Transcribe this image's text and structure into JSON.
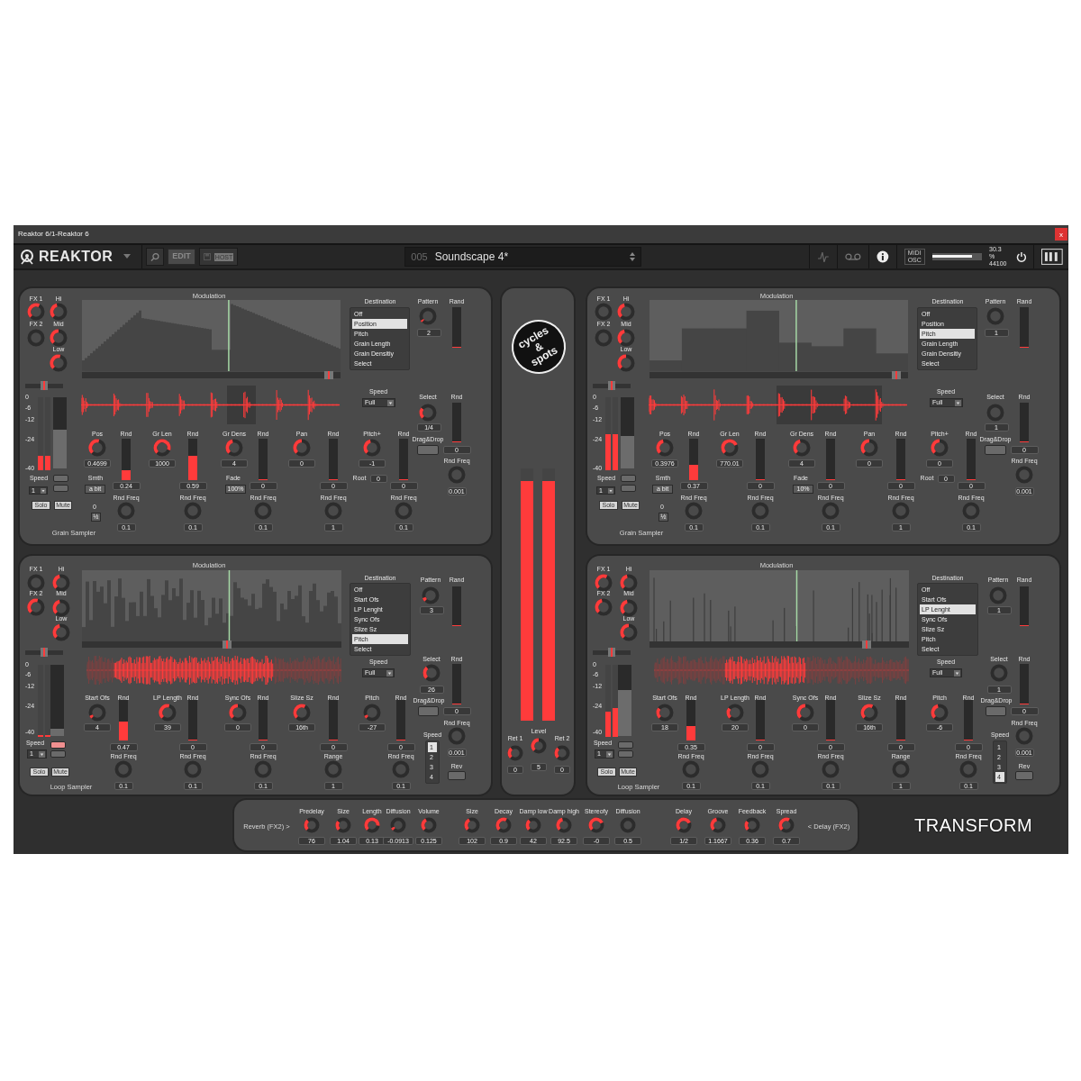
{
  "window": {
    "title": "Reaktor 6/1-Reaktor 6",
    "close": "x"
  },
  "toolbar": {
    "app_name": "REAKTOR",
    "edit": "EDIT",
    "host": "HOST",
    "preset_number": "005",
    "preset_name": "Soundscape 4*",
    "midi": "MIDI",
    "osc": "OSC",
    "volume": {
      "level": 0.8
    },
    "cpu": "30.3 %",
    "sample_rate": "44100"
  },
  "samplers": [
    {
      "kind": "grain",
      "title": "Grain Sampler",
      "modulation_title": "Modulation",
      "fx": [
        {
          "label": "FX 1"
        },
        {
          "label": "FX 2"
        }
      ],
      "eq": [
        {
          "label": "Hi"
        },
        {
          "label": "Mid"
        },
        {
          "label": "Low"
        }
      ],
      "scale": [
        "0",
        "-6",
        "-12",
        "-24",
        "-40"
      ],
      "pan": {
        "level": 0.5
      },
      "meters": [
        {
          "level": 0.2
        },
        {
          "level": 0.2
        }
      ],
      "fader": {
        "level": 0.55
      },
      "speed": {
        "label": "Speed",
        "value": "1"
      },
      "toggles": [
        {
          "on": false
        },
        {
          "on": false
        }
      ],
      "solo": "Solo",
      "mute": "Mute",
      "destination": {
        "label": "Destination",
        "items": [
          {
            "label": "Off",
            "selected": false
          },
          {
            "label": "Position",
            "selected": true
          },
          {
            "label": "Pitch",
            "selected": false
          },
          {
            "label": "Grain Length",
            "selected": false
          },
          {
            "label": "Grain Densitiy",
            "selected": false
          },
          {
            "label": "Select",
            "selected": false
          }
        ]
      },
      "pattern": {
        "label": "Pattern",
        "value": "2"
      },
      "rand": {
        "label": "Rand",
        "level": 0.02
      },
      "mod_speed": {
        "label": "Speed",
        "value": "Full"
      },
      "select": {
        "label": "Select",
        "value": "1/4"
      },
      "select_rnd": {
        "label": "Rnd",
        "value": "0",
        "level": 0.02
      },
      "drag_drop": "Drag&Drop",
      "rnd_freq": {
        "label": "Rnd Freq",
        "value": "0.001"
      },
      "params": [
        {
          "label": "Pos",
          "value": "0.4699",
          "rnd": {
            "label": "Rnd",
            "value": "0.24",
            "level": 0.24
          },
          "freq": {
            "label": "Rnd Freq",
            "value": "0.1"
          }
        },
        {
          "label": "Gr Len",
          "value": "1000",
          "rnd": {
            "label": "Rnd",
            "value": "0.59",
            "level": 0.59
          },
          "freq": {
            "label": "Rnd Freq",
            "value": "0.1"
          }
        },
        {
          "label": "Gr Dens",
          "value": "4",
          "rnd": {
            "label": "Rnd",
            "value": "0",
            "level": 0.02
          },
          "freq": {
            "label": "Rnd Freq",
            "value": "0.1"
          }
        },
        {
          "label": "Pan",
          "value": "0",
          "rnd": {
            "label": "Rnd",
            "value": "0",
            "level": 0.02
          },
          "freq": {
            "label": "Rnd Freq",
            "value": "1"
          }
        },
        {
          "label": "Pitch+",
          "value": "-1",
          "rnd": {
            "label": "Rnd",
            "value": "0",
            "level": 0.02
          },
          "freq": {
            "label": "Rnd Freq",
            "value": "0.1"
          }
        }
      ],
      "extras": [
        {
          "kind": "button",
          "label": "Smth",
          "value": "a bit"
        },
        {
          "kind": "button",
          "label": "0",
          "value": "½"
        },
        {
          "kind": "button",
          "label": "Fade",
          "value": "100%"
        },
        {
          "kind": "readout",
          "label": "Root",
          "value": "0"
        }
      ]
    },
    {
      "kind": "grain",
      "title": "Grain Sampler",
      "modulation_title": "Modulation",
      "fx": [
        {
          "label": "FX 1"
        },
        {
          "label": "FX 2"
        }
      ],
      "eq": [
        {
          "label": "Hi"
        },
        {
          "label": "Mid"
        },
        {
          "label": "Low"
        }
      ],
      "scale": [
        "0",
        "-6",
        "-12",
        "-24",
        "-40"
      ],
      "pan": {
        "level": 0.5
      },
      "meters": [
        {
          "level": 0.5
        },
        {
          "level": 0.5
        }
      ],
      "fader": {
        "level": 0.45
      },
      "speed": {
        "label": "Speed",
        "value": "1"
      },
      "toggles": [
        {
          "on": false
        },
        {
          "on": false
        }
      ],
      "solo": "Solo",
      "mute": "Mute",
      "destination": {
        "label": "Destination",
        "items": [
          {
            "label": "Off",
            "selected": false
          },
          {
            "label": "Position",
            "selected": false
          },
          {
            "label": "Pitch",
            "selected": true
          },
          {
            "label": "Grain Length",
            "selected": false
          },
          {
            "label": "Grain Densitiy",
            "selected": false
          },
          {
            "label": "Select",
            "selected": false
          }
        ]
      },
      "pattern": {
        "label": "Pattern",
        "value": "1"
      },
      "rand": {
        "label": "Rand",
        "level": 0.02
      },
      "mod_speed": {
        "label": "Speed",
        "value": "Full"
      },
      "select": {
        "label": "Select",
        "value": "1"
      },
      "select_rnd": {
        "label": "Rnd",
        "value": "0",
        "level": 0.02
      },
      "drag_drop": "Drag&Drop",
      "rnd_freq": {
        "label": "Rnd Freq",
        "value": "0.001"
      },
      "params": [
        {
          "label": "Pos",
          "value": "0.3976",
          "rnd": {
            "label": "Rnd",
            "value": "0.37",
            "level": 0.37
          },
          "freq": {
            "label": "Rnd Freq",
            "value": "0.1"
          }
        },
        {
          "label": "Gr Len",
          "value": "770.01",
          "rnd": {
            "label": "Rnd",
            "value": "0",
            "level": 0.02
          },
          "freq": {
            "label": "Rnd Freq",
            "value": "0.1"
          }
        },
        {
          "label": "Gr Dens",
          "value": "4",
          "rnd": {
            "label": "Rnd",
            "value": "0",
            "level": 0.02
          },
          "freq": {
            "label": "Rnd Freq",
            "value": "0.1"
          }
        },
        {
          "label": "Pan",
          "value": "0",
          "rnd": {
            "label": "Rnd",
            "value": "0",
            "level": 0.02
          },
          "freq": {
            "label": "Rnd Freq",
            "value": "1"
          }
        },
        {
          "label": "Pitch+",
          "value": "0",
          "rnd": {
            "label": "Rnd",
            "value": "0",
            "level": 0.02
          },
          "freq": {
            "label": "Rnd Freq",
            "value": "0.1"
          }
        }
      ],
      "extras": [
        {
          "kind": "button",
          "label": "Smth",
          "value": "a bit"
        },
        {
          "kind": "button",
          "label": "0",
          "value": "½"
        },
        {
          "kind": "button",
          "label": "Fade",
          "value": "10%"
        },
        {
          "kind": "readout",
          "label": "Root",
          "value": "0"
        }
      ]
    },
    {
      "kind": "loop",
      "title": "Loop Sampler",
      "modulation_title": "Modulation",
      "fx": [
        {
          "label": "FX 1"
        },
        {
          "label": "FX 2"
        }
      ],
      "eq": [
        {
          "label": "Hi"
        },
        {
          "label": "Mid"
        },
        {
          "label": "Low"
        }
      ],
      "scale": [
        "0",
        "-6",
        "-12",
        "-24",
        "-40"
      ],
      "pan": {
        "level": 0.5
      },
      "meters": [
        {
          "level": 0.03
        },
        {
          "level": 0.03
        }
      ],
      "fader": {
        "level": 0.1
      },
      "speed": {
        "label": "Speed",
        "value": "1"
      },
      "toggles": [
        {
          "on": true
        },
        {
          "on": false
        }
      ],
      "solo": "Solo",
      "mute": "Mute",
      "destination": {
        "label": "Destination",
        "items": [
          {
            "label": "Off",
            "selected": false
          },
          {
            "label": "Start Ofs",
            "selected": false
          },
          {
            "label": "LP Lenght",
            "selected": false
          },
          {
            "label": "Sync Ofs",
            "selected": false
          },
          {
            "label": "Slize Sz",
            "selected": false
          },
          {
            "label": "Pitch",
            "selected": true
          },
          {
            "label": "Select",
            "selected": false
          }
        ]
      },
      "pattern": {
        "label": "Pattern",
        "value": "3"
      },
      "rand": {
        "label": "Rand",
        "level": 0.02
      },
      "mod_speed": {
        "label": "Speed",
        "value": "Full"
      },
      "select": {
        "label": "Select",
        "value": "26"
      },
      "select_rnd": {
        "label": "Rnd",
        "value": "0",
        "level": 0.02
      },
      "drag_drop": "Drag&Drop",
      "rnd_freq": {
        "label": "Rnd Freq",
        "value": "0.001"
      },
      "params": [
        {
          "label": "Start Ofs",
          "value": "4",
          "rnd": {
            "label": "Rnd",
            "value": "0.47",
            "level": 0.47
          },
          "freq": {
            "label": "Rnd Freq",
            "value": "0.1"
          }
        },
        {
          "label": "LP Length",
          "value": "39",
          "rnd": {
            "label": "Rnd",
            "value": "0",
            "level": 0.02
          },
          "freq": {
            "label": "Rnd Freq",
            "value": "0.1"
          }
        },
        {
          "label": "Sync Ofs",
          "value": "0",
          "rnd": {
            "label": "Rnd",
            "value": "0",
            "level": 0.02
          },
          "freq": {
            "label": "Rnd Freq",
            "value": "0.1"
          }
        },
        {
          "label": "Slize Sz",
          "value": "16th",
          "rnd": {
            "label": "Rnd",
            "value": "0",
            "level": 0.02
          },
          "freq": {
            "label": "Range",
            "value": "1"
          }
        },
        {
          "label": "Pitch",
          "value": "-27",
          "rnd": {
            "label": "Rnd",
            "value": "0",
            "level": 0.02
          },
          "freq": {
            "label": "Rnd Freq",
            "value": "0.1"
          }
        }
      ],
      "speed_list": {
        "label": "Speed",
        "items": [
          {
            "label": "1",
            "selected": true
          },
          {
            "label": "2",
            "selected": false
          },
          {
            "label": "3",
            "selected": false
          },
          {
            "label": "4",
            "selected": false
          }
        ]
      },
      "rev": "Rev"
    },
    {
      "kind": "loop",
      "title": "Loop Sampler",
      "modulation_title": "Modulation",
      "fx": [
        {
          "label": "FX 1"
        },
        {
          "label": "FX 2"
        }
      ],
      "eq": [
        {
          "label": "Hi"
        },
        {
          "label": "Mid"
        },
        {
          "label": "Low"
        }
      ],
      "scale": [
        "0",
        "-6",
        "-12",
        "-24",
        "-40"
      ],
      "pan": {
        "level": 0.5
      },
      "meters": [
        {
          "level": 0.35
        },
        {
          "level": 0.4
        }
      ],
      "fader": {
        "level": 0.65
      },
      "speed": {
        "label": "Speed",
        "value": "1"
      },
      "toggles": [
        {
          "on": false
        },
        {
          "on": false
        }
      ],
      "solo": "Solo",
      "mute": "Mute",
      "destination": {
        "label": "Destination",
        "items": [
          {
            "label": "Off",
            "selected": false
          },
          {
            "label": "Start Ofs",
            "selected": false
          },
          {
            "label": "LP Lenght",
            "selected": true
          },
          {
            "label": "Sync Ofs",
            "selected": false
          },
          {
            "label": "Slize Sz",
            "selected": false
          },
          {
            "label": "Pitch",
            "selected": false
          },
          {
            "label": "Select",
            "selected": false
          }
        ]
      },
      "pattern": {
        "label": "Pattern",
        "value": "1"
      },
      "rand": {
        "label": "Rand",
        "level": 0.02
      },
      "mod_speed": {
        "label": "Speed",
        "value": "Full"
      },
      "select": {
        "label": "Select",
        "value": "1"
      },
      "select_rnd": {
        "label": "Rnd",
        "value": "0",
        "level": 0.02
      },
      "drag_drop": "Drag&Drop",
      "rnd_freq": {
        "label": "Rnd Freq",
        "value": "0.001"
      },
      "params": [
        {
          "label": "Start Ofs",
          "value": "18",
          "rnd": {
            "label": "Rnd",
            "value": "0.35",
            "level": 0.35
          },
          "freq": {
            "label": "Rnd Freq",
            "value": "0.1"
          }
        },
        {
          "label": "LP Length",
          "value": "20",
          "rnd": {
            "label": "Rnd",
            "value": "0",
            "level": 0.02
          },
          "freq": {
            "label": "Rnd Freq",
            "value": "0.1"
          }
        },
        {
          "label": "Sync Ofs",
          "value": "0",
          "rnd": {
            "label": "Rnd",
            "value": "0",
            "level": 0.02
          },
          "freq": {
            "label": "Rnd Freq",
            "value": "0.1"
          }
        },
        {
          "label": "Slize Sz",
          "value": "16th",
          "rnd": {
            "label": "Rnd",
            "value": "0",
            "level": 0.02
          },
          "freq": {
            "label": "Range",
            "value": "1"
          }
        },
        {
          "label": "Pitch",
          "value": "-6",
          "rnd": {
            "label": "Rnd",
            "value": "0",
            "level": 0.02
          },
          "freq": {
            "label": "Rnd Freq",
            "value": "0.1"
          }
        }
      ],
      "speed_list": {
        "label": "Speed",
        "items": [
          {
            "label": "1",
            "selected": false
          },
          {
            "label": "2",
            "selected": false
          },
          {
            "label": "3",
            "selected": false
          },
          {
            "label": "4",
            "selected": true
          }
        ]
      },
      "rev": "Rev"
    }
  ],
  "master": {
    "logo": [
      "cycles",
      "&",
      "spots"
    ],
    "meters": [
      {
        "level": 0.95
      },
      {
        "level": 0.95
      }
    ],
    "knobs": [
      {
        "label": "Ret 1",
        "value": "0"
      },
      {
        "label": "Level",
        "value": "5"
      },
      {
        "label": "Ret 2",
        "value": "0"
      }
    ]
  },
  "effects": {
    "reverb_label": "Reverb (FX2) >",
    "delay_label": "< Delay (FX2)",
    "knobs": [
      {
        "label": "Predelay",
        "value": "76"
      },
      {
        "label": "Size",
        "value": "1.04"
      },
      {
        "label": "Length",
        "value": "0.13"
      },
      {
        "label": "Diffusion",
        "value": "-0.0913"
      },
      {
        "label": "Volume",
        "value": "0.125"
      },
      {
        "label": "Size",
        "value": "102"
      },
      {
        "label": "Decay",
        "value": "0.9"
      },
      {
        "label": "Damp low",
        "value": "42"
      },
      {
        "label": "Damp high",
        "value": "92.5"
      },
      {
        "label": "Stereofy",
        "value": "-0"
      },
      {
        "label": "Diffusion",
        "value": "0.5"
      },
      {
        "label": "Delay",
        "value": "1/2"
      },
      {
        "label": "Groove",
        "value": "1.1667"
      },
      {
        "label": "Feedback",
        "value": "0.36"
      },
      {
        "label": "Spread",
        "value": "0.7"
      }
    ]
  },
  "brand": "TRANSFORM"
}
